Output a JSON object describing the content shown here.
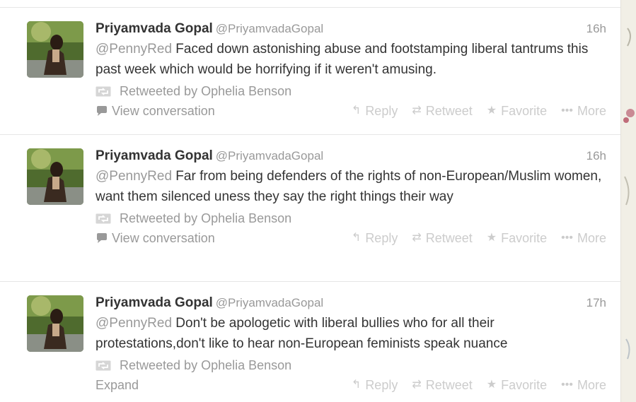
{
  "tweets": [
    {
      "fullname": "Priyamvada Gopal",
      "username": "@PriyamvadaGopal",
      "time": "16h",
      "mention": "@PennyRed",
      "text": " Faced down astonishing abuse and footstamping liberal tantrums this past week which would be horrifying if it weren't amusing.",
      "context": "Retweeted by Ophelia Benson",
      "details": "View conversation"
    },
    {
      "fullname": "Priyamvada Gopal",
      "username": "@PriyamvadaGopal",
      "time": "16h",
      "mention": "@PennyRed",
      "text": " Far from being defenders of the rights of non-European/Muslim women, want them silenced uness they say the right things their way",
      "context": "Retweeted by Ophelia Benson",
      "details": "View conversation"
    },
    {
      "fullname": "Priyamvada Gopal",
      "username": "@PriyamvadaGopal",
      "time": "17h",
      "mention": "@PennyRed",
      "text": " Don't be  apologetic with liberal bullies who for all their protestations,don't like to hear non-European feminists speak nuance",
      "context": "Retweeted by Ophelia Benson",
      "details": "Expand"
    }
  ],
  "actions": {
    "reply": "Reply",
    "retweet": "Retweet",
    "favorite": "Favorite",
    "more": "More"
  },
  "icons": {
    "reply": "reply-arrow-icon",
    "retweet": "retweet-icon",
    "favorite": "star-icon",
    "more": "ellipsis-icon",
    "conversation": "speech-bubble-icon"
  },
  "colors": {
    "text": "#333333",
    "muted": "#999999",
    "action": "#cccccc",
    "background": "#f1efe6"
  }
}
